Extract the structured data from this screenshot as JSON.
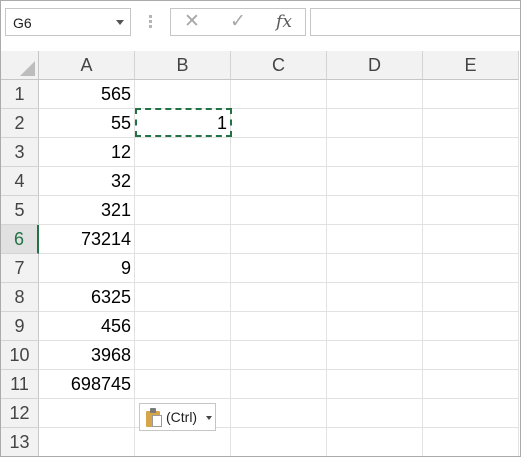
{
  "formula_bar": {
    "name_box": "G6",
    "cancel_icon": "✕",
    "enter_icon": "✓",
    "function_icon": "fx",
    "formula_value": ""
  },
  "sheet": {
    "columns": [
      "A",
      "B",
      "C",
      "D",
      "E"
    ],
    "rows": [
      "1",
      "2",
      "3",
      "4",
      "5",
      "6",
      "7",
      "8",
      "9",
      "10",
      "11",
      "12",
      "13"
    ],
    "active_row": "6",
    "cells": {
      "A1": "565",
      "A2": "55",
      "A3": "12",
      "A4": "32",
      "A5": "321",
      "A6": "73214",
      "A7": "9",
      "A8": "6325",
      "A9": "456",
      "A10": "3968",
      "A11": "698745",
      "B2": "1"
    },
    "copied_cell": "B2"
  },
  "paste_options": {
    "label": "(Ctrl)",
    "icon": "clipboard-icon"
  },
  "colors": {
    "accent": "#217346",
    "header_bg": "#f2f2f2",
    "gridline": "#e1e1e1"
  }
}
